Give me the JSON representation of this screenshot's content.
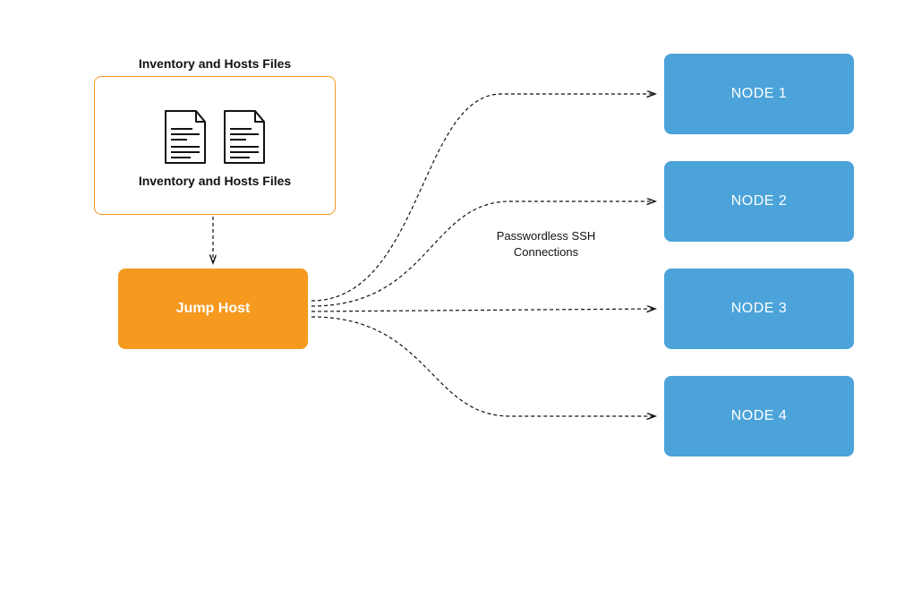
{
  "filesBox": {
    "titleAbove": "Inventory and Hosts Files",
    "labelInside": "Inventory and Hosts Files"
  },
  "jumpHost": {
    "label": "Jump Host"
  },
  "sshLabel": "Passwordless SSH Connections",
  "nodes": [
    {
      "label": "NODE 1"
    },
    {
      "label": "NODE 2"
    },
    {
      "label": "NODE 3"
    },
    {
      "label": "NODE 4"
    }
  ],
  "colors": {
    "orange": "#f5991f",
    "blue": "#4ba3da"
  }
}
